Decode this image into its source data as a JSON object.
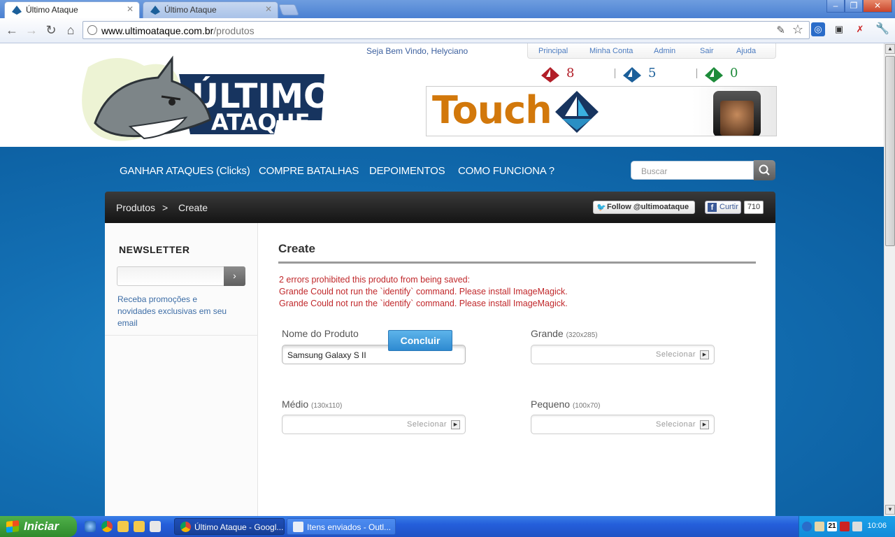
{
  "browser": {
    "tabs": [
      {
        "title": "Último Ataque",
        "active": true
      },
      {
        "title": "Último Ataque",
        "active": false
      }
    ],
    "url_host": "www.ultimoataque.com.br",
    "url_path": "/produtos",
    "window_buttons": [
      "–",
      "❐",
      "✕"
    ]
  },
  "header": {
    "welcome": "Seja Bem Vindo, Helyciano",
    "top_menu": [
      "Principal",
      "Minha Conta",
      "Admin",
      "Sair",
      "Ajuda"
    ],
    "counters": [
      {
        "value": "8",
        "color": "#b21e28"
      },
      {
        "value": "5",
        "color": "#1b5f9a"
      },
      {
        "value": "0",
        "color": "#1d8b3a"
      }
    ],
    "banner_text": "Touch"
  },
  "nav": {
    "items": [
      "GANHAR ATAQUES (Clicks)",
      "COMPRE BATALHAS",
      "DEPOIMENTOS",
      "COMO FUNCIONA ?"
    ],
    "search_placeholder": "Buscar"
  },
  "breadcrumb": {
    "items": [
      "Produtos",
      ">",
      "Create"
    ],
    "follow_label": "Follow @ultimoataque",
    "like_label": "Curtir",
    "like_count": "710"
  },
  "sidebar": {
    "newsletter_title": "NEWSLETTER",
    "newsletter_text": "Receba promoções e novidades exclusivas em seu email"
  },
  "form": {
    "title": "Create",
    "errors": [
      "2 errors prohibited this produto from being saved:",
      "Grande Could not run the `identify` command. Please install ImageMagick.",
      "Grande Could not run the `identify` command. Please install ImageMagick."
    ],
    "fields": {
      "nome": {
        "label": "Nome do Produto",
        "value": "Samsung Galaxy S II"
      },
      "grande": {
        "label": "Grande",
        "hint": "(320x285)",
        "button": "Selecionar"
      },
      "medio": {
        "label": "Médio",
        "hint": "(130x110)",
        "button": "Selecionar"
      },
      "pequeno": {
        "label": "Pequeno",
        "hint": "(100x70)",
        "button": "Selecionar"
      }
    },
    "submit_label": "Concluir"
  },
  "taskbar": {
    "start_label": "Iniciar",
    "tasks": [
      "Último Ataque - Googl...",
      "Itens enviados - Outl..."
    ],
    "tray_number": "21",
    "clock": "10:06"
  }
}
